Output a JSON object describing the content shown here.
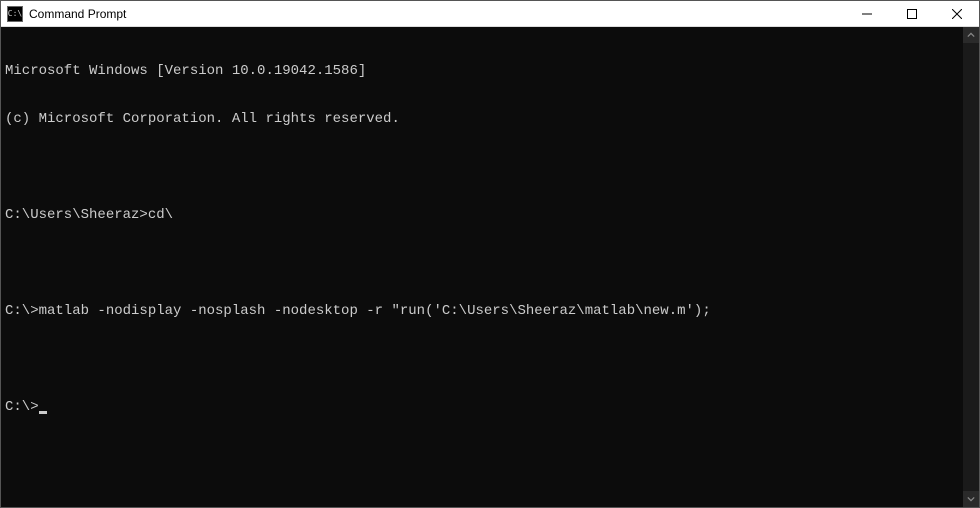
{
  "window": {
    "title": "Command Prompt",
    "icon_label": "C:\\"
  },
  "terminal": {
    "lines": [
      "Microsoft Windows [Version 10.0.19042.1586]",
      "(c) Microsoft Corporation. All rights reserved.",
      "",
      "C:\\Users\\Sheeraz>cd\\",
      "",
      "C:\\>matlab -nodisplay -nosplash -nodesktop -r \"run('C:\\Users\\Sheeraz\\matlab\\new.m');",
      "",
      "C:\\>"
    ]
  }
}
